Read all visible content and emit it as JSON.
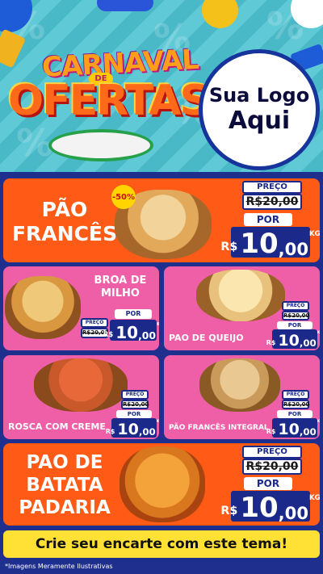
{
  "header": {
    "logo_top": "CARNAVAL",
    "logo_badge": "DE",
    "logo_main": "OFERTAS",
    "store_logo_line1": "Sua Logo",
    "store_logo_line2": "Aqui",
    "pattern_symbol": "%"
  },
  "labels": {
    "preco": "PREÇO",
    "por": "POR",
    "currency": "R$",
    "unit": "KG"
  },
  "products": [
    {
      "name_lines": [
        "PÃO",
        "FRANCÊS"
      ],
      "old_price": "R$20,00",
      "new_int": "10",
      "new_cents": ",00",
      "discount": "-50%"
    },
    {
      "name_lines": [
        "BROA DE",
        "MILHO"
      ],
      "old_price": "R$20,00",
      "new_int": "10",
      "new_cents": ",00"
    },
    {
      "name_lines": [
        "PAO DE QUEIJO"
      ],
      "old_price": "R$20,00",
      "new_int": "10",
      "new_cents": ",00"
    },
    {
      "name_lines": [
        "ROSCA COM CREME"
      ],
      "old_price": "R$20,00",
      "new_int": "10",
      "new_cents": ",00"
    },
    {
      "name_lines": [
        "PÃO FRANCÊS INTEGRAL"
      ],
      "old_price": "R$20,00",
      "new_int": "10",
      "new_cents": ",00"
    },
    {
      "name_lines": [
        "PAO DE",
        "BATATA",
        "PADARIA"
      ],
      "old_price": "R$20,00",
      "new_int": "10",
      "new_cents": ",00"
    }
  ],
  "footer": {
    "cta": "Crie seu encarte com este tema!",
    "disclaimer": "*Imagens Meramente Ilustrativas"
  },
  "colors": {
    "orange": "#ff5a16",
    "pink": "#ef5fa8",
    "navy": "#1b2a8a",
    "yellow": "#ffe135",
    "teal": "#5fc9d6"
  }
}
